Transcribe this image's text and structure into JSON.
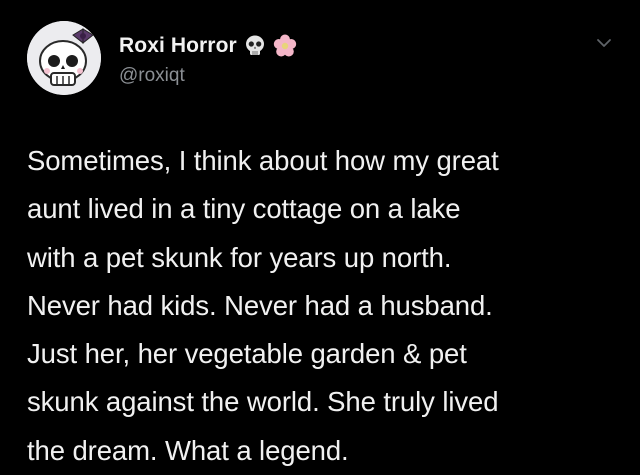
{
  "tweet": {
    "author": {
      "display_name": "Roxi Horror",
      "handle": "@roxiqt",
      "name_emojis": [
        "skull-emoji",
        "flower-emoji"
      ]
    },
    "body_lines": [
      "Sometimes, I think about how my great",
      "aunt lived in a tiny cottage on a lake",
      "with a pet skunk for years up north.",
      "Never had kids. Never had a husband.",
      "Just her, her vegetable garden & pet",
      "skunk against the world. She truly lived",
      "the dream. What a legend."
    ]
  },
  "colors": {
    "background": "#000000",
    "text": "#f1f1f1",
    "secondary_text": "#8b8f94",
    "flower_petals": "#f4b6c8"
  },
  "icons": {
    "menu": "chevron-down-icon"
  }
}
